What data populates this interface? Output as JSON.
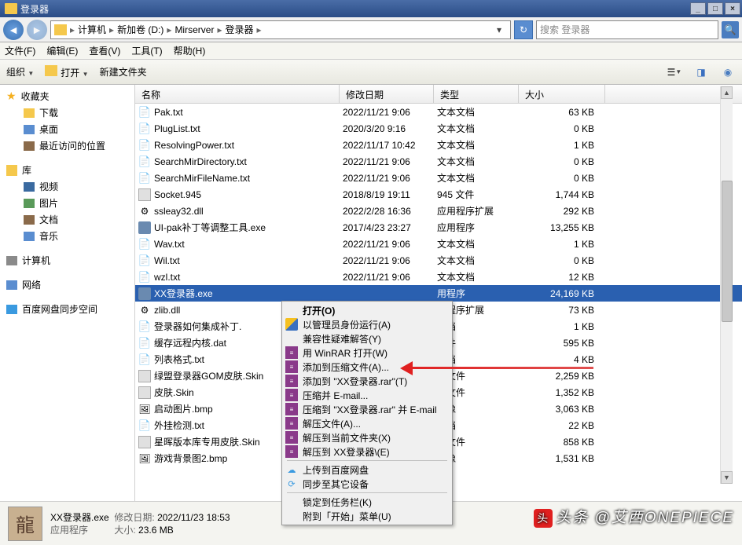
{
  "window": {
    "title": "登录器"
  },
  "breadcrumb": {
    "root": "计算机",
    "drive": "新加卷 (D:)",
    "dir1": "Mirserver",
    "dir2": "登录器"
  },
  "search": {
    "placeholder": "搜索 登录器"
  },
  "menubar": {
    "file": "文件(F)",
    "edit": "编辑(E)",
    "view": "查看(V)",
    "tools": "工具(T)",
    "help": "帮助(H)"
  },
  "toolbar": {
    "org": "组织",
    "open": "打开",
    "newfolder": "新建文件夹"
  },
  "sidebar": {
    "fav": "收藏夹",
    "downloads": "下载",
    "desktop": "桌面",
    "recent": "最近访问的位置",
    "lib": "库",
    "video": "视频",
    "pic": "图片",
    "doc": "文档",
    "music": "音乐",
    "computer": "计算机",
    "network": "网络",
    "baidu": "百度网盘同步空间"
  },
  "columns": {
    "name": "名称",
    "date": "修改日期",
    "type": "类型",
    "size": "大小"
  },
  "files": [
    {
      "icon": "txt",
      "name": "Pak.txt",
      "date": "2022/11/21 9:06",
      "type": "文本文档",
      "size": "63 KB"
    },
    {
      "icon": "txt",
      "name": "PlugList.txt",
      "date": "2020/3/20 9:16",
      "type": "文本文档",
      "size": "0 KB"
    },
    {
      "icon": "txt",
      "name": "ResolvingPower.txt",
      "date": "2022/11/17 10:42",
      "type": "文本文档",
      "size": "1 KB"
    },
    {
      "icon": "txt",
      "name": "SearchMirDirectory.txt",
      "date": "2022/11/21 9:06",
      "type": "文本文档",
      "size": "0 KB"
    },
    {
      "icon": "txt",
      "name": "SearchMirFileName.txt",
      "date": "2022/11/21 9:06",
      "type": "文本文档",
      "size": "0 KB"
    },
    {
      "icon": "unk",
      "name": "Socket.945",
      "date": "2018/8/19 19:11",
      "type": "945 文件",
      "size": "1,744 KB"
    },
    {
      "icon": "dll",
      "name": "ssleay32.dll",
      "date": "2022/2/28 16:36",
      "type": "应用程序扩展",
      "size": "292 KB"
    },
    {
      "icon": "exe",
      "name": "UI-pak补丁等调整工具.exe",
      "date": "2017/4/23 23:27",
      "type": "应用程序",
      "size": "13,255 KB"
    },
    {
      "icon": "txt",
      "name": "Wav.txt",
      "date": "2022/11/21 9:06",
      "type": "文本文档",
      "size": "1 KB"
    },
    {
      "icon": "txt",
      "name": "Wil.txt",
      "date": "2022/11/21 9:06",
      "type": "文本文档",
      "size": "0 KB"
    },
    {
      "icon": "txt",
      "name": "wzl.txt",
      "date": "2022/11/21 9:06",
      "type": "文本文档",
      "size": "12 KB"
    },
    {
      "icon": "exe",
      "name": "XX登录器.exe",
      "date": "",
      "type": "用程序",
      "size": "24,169 KB",
      "selected": true
    },
    {
      "icon": "dll",
      "name": "zlib.dll",
      "date": "",
      "type": "用程序扩展",
      "size": "73 KB"
    },
    {
      "icon": "txt",
      "name": "登录器如何集成补丁.",
      "date": "",
      "type": "文档",
      "size": "1 KB"
    },
    {
      "icon": "dat",
      "name": "缓存远程内核.dat",
      "date": "",
      "type": "文件",
      "size": "595 KB"
    },
    {
      "icon": "txt",
      "name": "列表格式.txt",
      "date": "",
      "type": "文档",
      "size": "4 KB"
    },
    {
      "icon": "unk",
      "name": "绿盟登录器GOM皮肤.Skin",
      "date": "",
      "type": "N 文件",
      "size": "2,259 KB"
    },
    {
      "icon": "unk",
      "name": "皮肤.Skin",
      "date": "",
      "type": "N 文件",
      "size": "1,352 KB"
    },
    {
      "icon": "bmp",
      "name": "启动图片.bmp",
      "date": "",
      "type": "图像",
      "size": "3,063 KB"
    },
    {
      "icon": "txt",
      "name": "外挂检测.txt",
      "date": "",
      "type": "文档",
      "size": "22 KB"
    },
    {
      "icon": "unk",
      "name": "星晖版本库专用皮肤.Skin",
      "date": "",
      "type": "N 文件",
      "size": "858 KB"
    },
    {
      "icon": "bmp",
      "name": "游戏背景图2.bmp",
      "date": "",
      "type": "图像",
      "size": "1,531 KB"
    }
  ],
  "context_menu": {
    "open": "打开(O)",
    "runas": "以管理员身份运行(A)",
    "troubleshoot": "兼容性疑难解答(Y)",
    "winrar_open": "用 WinRAR 打开(W)",
    "add_archive": "添加到压缩文件(A)...",
    "add_to_rar": "添加到 \"XX登录器.rar\"(T)",
    "compress_email": "压缩并 E-mail...",
    "compress_rar_email": "压缩到 \"XX登录器.rar\" 并 E-mail",
    "extract": "解压文件(A)...",
    "extract_here": "解压到当前文件夹(X)",
    "extract_to": "解压到 XX登录器\\(E)",
    "upload_baidu": "上传到百度网盘",
    "sync_other": "同步至其它设备",
    "pin_taskbar": "锁定到任务栏(K)",
    "pin_start": "附到「开始」菜单(U)"
  },
  "statusbar": {
    "filename": "XX登录器.exe",
    "filetype": "应用程序",
    "date_label": "修改日期:",
    "date_value": "2022/11/23 18:53",
    "size_label": "大小:",
    "size_value": "23.6 MB"
  },
  "watermark": "头条 @艾西ONEPIECE"
}
